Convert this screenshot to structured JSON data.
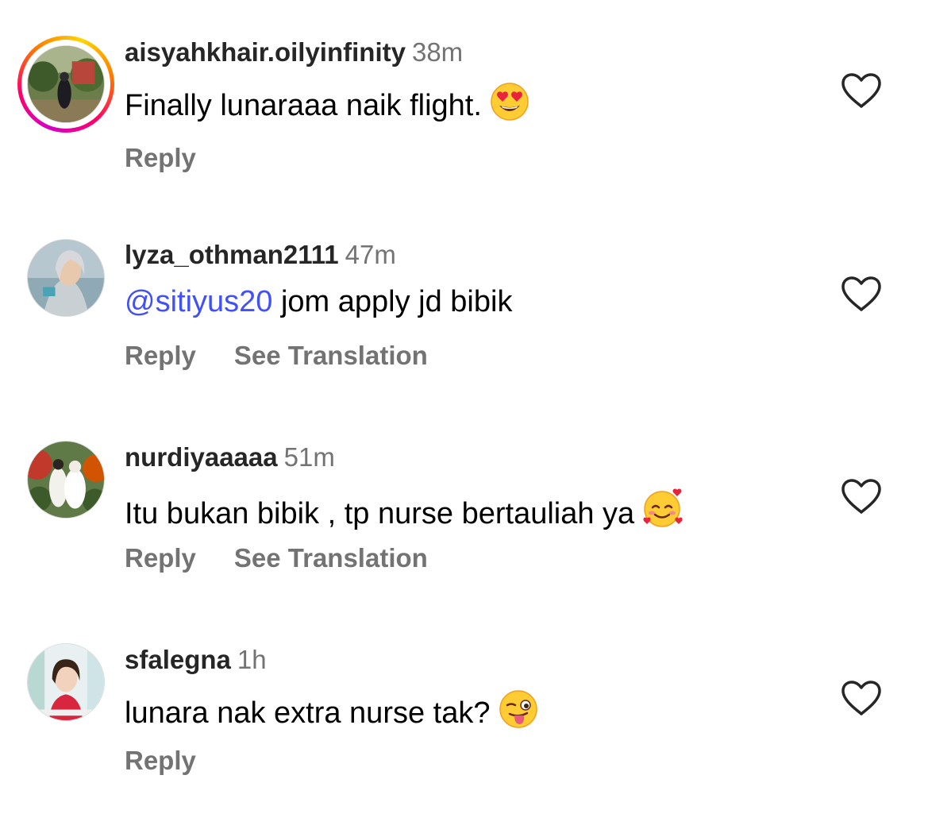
{
  "comments": [
    {
      "username": "aisyahkhair.oilyinfinity",
      "time": "38m",
      "text": "Finally lunaraaa naik flight.",
      "emoji": "smiling-face-with-heart-eyes",
      "has_story_ring": true,
      "actions": {
        "reply": "Reply"
      }
    },
    {
      "username": "lyza_othman2111",
      "time": "47m",
      "mention": "@sitiyus20",
      "text": " jom apply jd bibik",
      "actions": {
        "reply": "Reply",
        "see_translation": "See Translation"
      }
    },
    {
      "username": "nurdiyaaaaa",
      "time": "51m",
      "text": "Itu bukan bibik , tp nurse bertauliah ya",
      "emoji": "smiling-face-with-hearts",
      "actions": {
        "reply": "Reply",
        "see_translation": "See Translation"
      }
    },
    {
      "username": "sfalegna",
      "time": "1h",
      "text": "lunara nak extra nurse tak?",
      "emoji": "winking-face-with-tongue",
      "actions": {
        "reply": "Reply"
      }
    }
  ],
  "colors": {
    "username": "#262626",
    "meta": "#737373",
    "mention": "#4150f7",
    "story_ring": [
      "#d300c5",
      "#ff0069",
      "#ff7a00",
      "#ffd600"
    ]
  },
  "icons": {
    "like": "heart-outline-icon"
  }
}
